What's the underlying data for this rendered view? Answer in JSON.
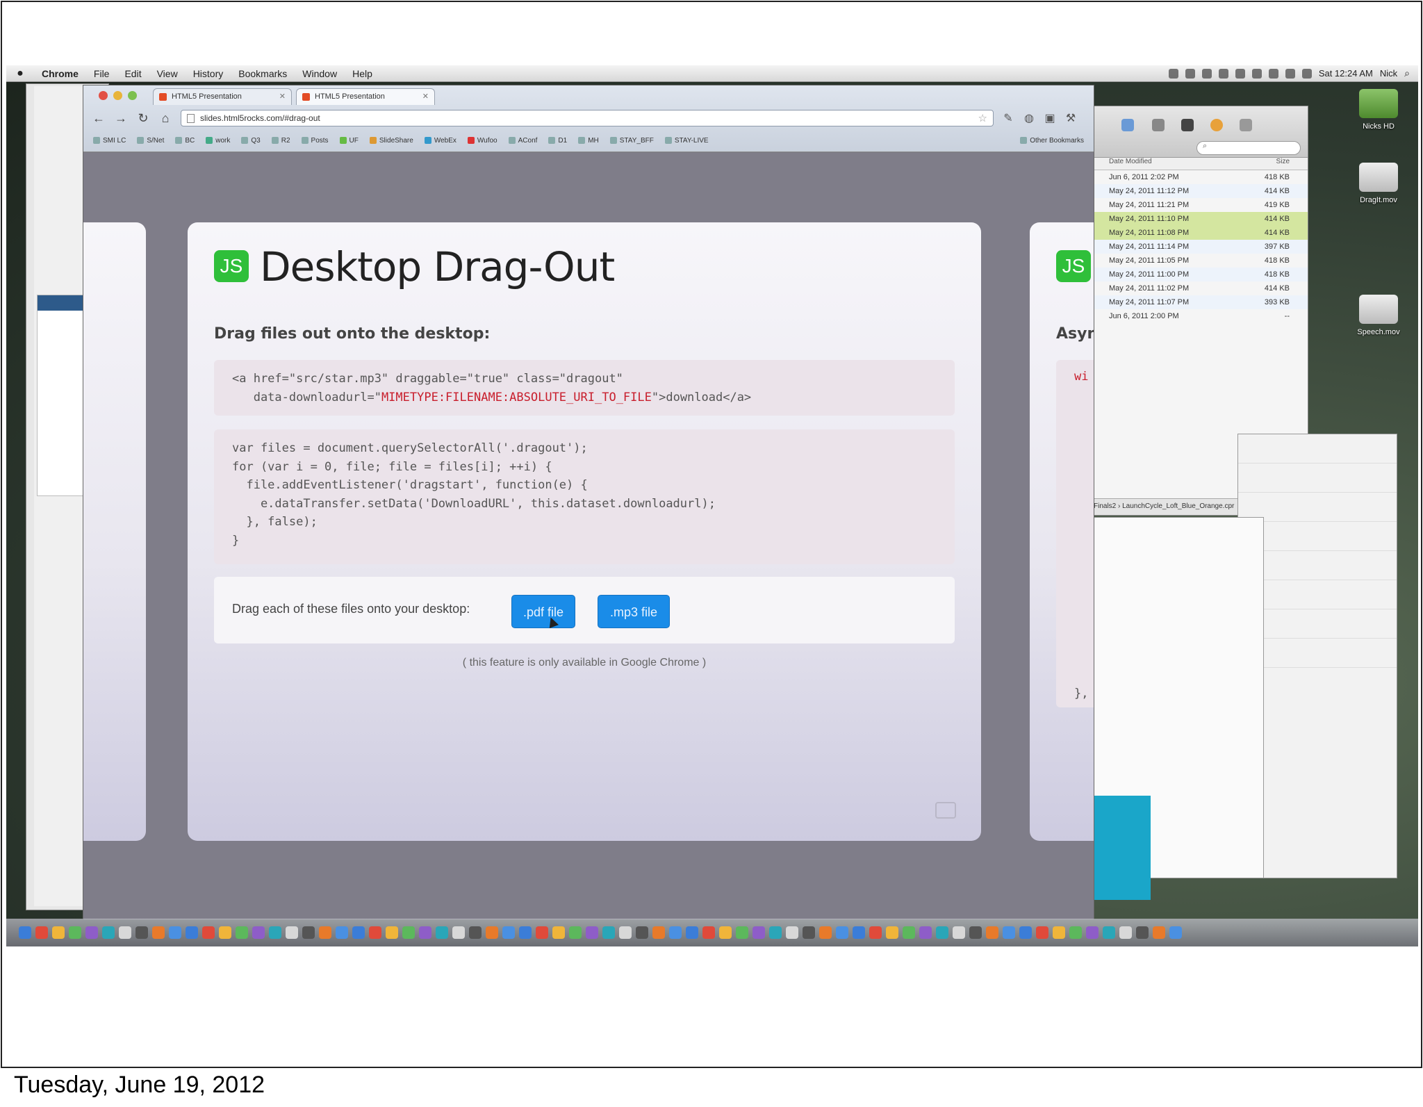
{
  "footer": {
    "date": "Tuesday, June 19, 2012"
  },
  "menubar": {
    "items": [
      "Chrome",
      "File",
      "Edit",
      "View",
      "History",
      "Bookmarks",
      "Window",
      "Help"
    ],
    "clock": "Sat 12:24 AM",
    "user": "Nick"
  },
  "browser": {
    "tabs": [
      "HTML5 Presentation",
      "HTML5 Presentation"
    ],
    "url": "slides.html5rocks.com/#drag-out",
    "bookmarks": [
      "SMI LC",
      "S/Net",
      "BC",
      "work",
      "Q3",
      "R2",
      "Posts",
      "UF",
      "SlideShare",
      "WebEx",
      "Wufoo",
      "AConf",
      "D1",
      "MH",
      "STAY_BFF",
      "STAY-LIVE",
      "Other Bookmarks"
    ]
  },
  "slide": {
    "badge": "JS",
    "title": "Desktop Drag-Out",
    "subtitle": "Drag files out onto the desktop:",
    "code1_line1": "<a href=\"src/star.mp3\" draggable=\"true\" class=\"dragout\"",
    "code1_line2_pre": "   data-downloadurl=\"",
    "code1_line2_hl": "MIMETYPE:FILENAME:ABSOLUTE_URI_TO_FILE",
    "code1_line2_post": "\">download</a>",
    "code2": "var files = document.querySelectorAll('.dragout');\nfor (var i = 0, file; file = files[i]; ++i) {\n  file.addEventListener('dragstart', function(e) {\n    e.dataTransfer.setData('DownloadURL', this.dataset.downloadurl);\n  }, false);\n}",
    "demo_label": "Drag each of these files onto your desktop:",
    "pdf_button": ".pdf file",
    "mp3_button": ".mp3 file",
    "note": "( this feature is only available in Google Chrome )"
  },
  "next_slide": {
    "badge": "JS",
    "title_partial": "Asyn",
    "code_partial": "wi",
    "code_end": "},"
  },
  "finder": {
    "column_date": "Date Modified",
    "column_size": "Size",
    "rows": [
      {
        "date": "Jun 6, 2011 2:02 PM",
        "size": "418 KB"
      },
      {
        "date": "May 24, 2011 11:12 PM",
        "size": "414 KB"
      },
      {
        "date": "May 24, 2011 11:21 PM",
        "size": "419 KB"
      },
      {
        "date": "May 24, 2011 11:10 PM",
        "size": "414 KB"
      },
      {
        "date": "May 24, 2011 11:08 PM",
        "size": "414 KB"
      },
      {
        "date": "May 24, 2011 11:14 PM",
        "size": "397 KB"
      },
      {
        "date": "May 24, 2011 11:05 PM",
        "size": "418 KB"
      },
      {
        "date": "May 24, 2011 11:00 PM",
        "size": "418 KB"
      },
      {
        "date": "May 24, 2011 11:02 PM",
        "size": "414 KB"
      },
      {
        "date": "May 24, 2011 11:07 PM",
        "size": "393 KB"
      },
      {
        "date": "Jun 6, 2011 2:00 PM",
        "size": "--"
      }
    ],
    "path": "Finals2 › LaunchCycle_Loft_Blue_Orange.cpr"
  },
  "desktop_icons": [
    "Nicks HD",
    "DragIt.mov",
    "Speech.mov"
  ],
  "colors": {
    "accent_button": "#1a8ce8",
    "js_badge": "#2fbf3a",
    "highlight_code": "#c81e2c"
  }
}
